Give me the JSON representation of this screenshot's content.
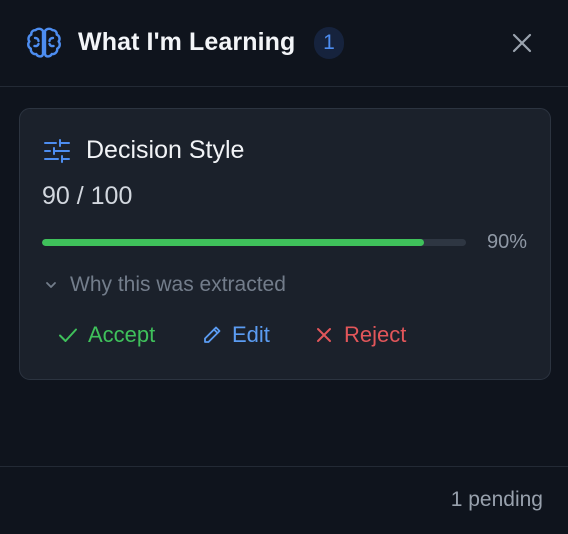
{
  "header": {
    "title": "What I'm Learning",
    "count": "1",
    "icon": "brain-icon",
    "accent": "#4d8df0"
  },
  "card": {
    "icon": "sliders-icon",
    "title": "Decision Style",
    "score": "90 / 100",
    "progress": 0.9,
    "percent_label": "90%",
    "why_label": "Why this was extracted",
    "actions": {
      "accept": "Accept",
      "edit": "Edit",
      "reject": "Reject"
    },
    "colors": {
      "accept": "#3fc15b",
      "edit": "#5b9cf2",
      "reject": "#e2565a"
    }
  },
  "footer": {
    "pending": "1 pending"
  }
}
